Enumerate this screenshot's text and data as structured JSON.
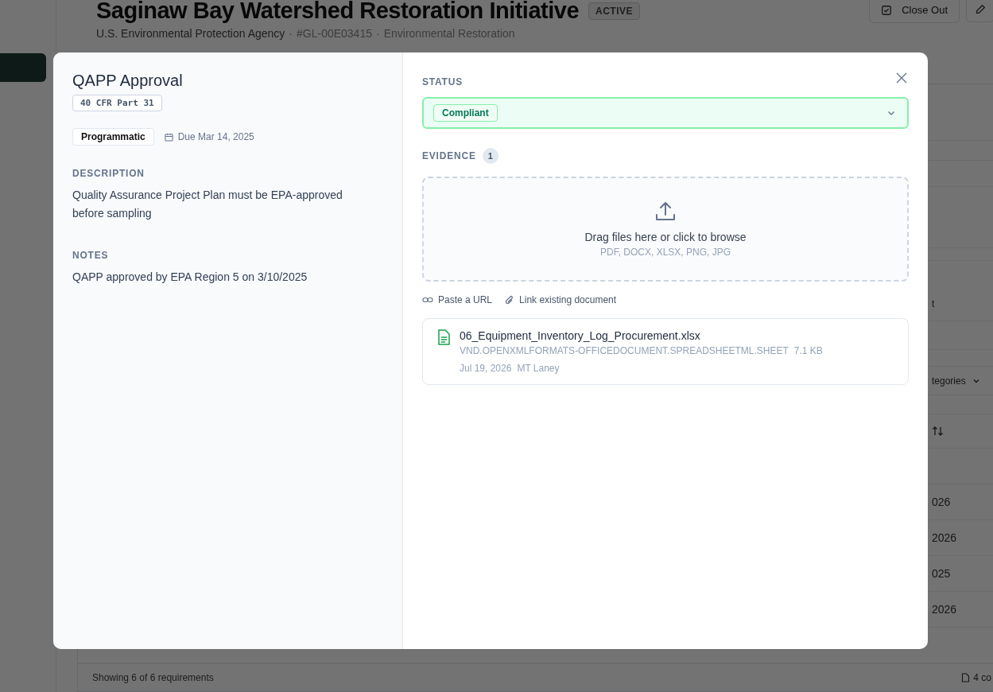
{
  "page": {
    "title": "Saginaw Bay Watershed Restoration Initiative",
    "status_badge": "ACTIVE",
    "subtitle": [
      "U.S. Environmental Protection Agency",
      "#GL-00E03415",
      "Environmental Restoration"
    ],
    "subtitle_separator": "·",
    "close_out_button": "Close Out",
    "table": {
      "column_fragment": "t",
      "filter_fragment": "tegories",
      "date_fragments": [
        "026",
        "2026",
        "025",
        "2026"
      ]
    },
    "footer": {
      "count": "Showing 6 of 6 requirements",
      "documents_fragment": "4 co"
    }
  },
  "modal": {
    "title": "QAPP Approval",
    "citation": "40 CFR Part 31",
    "category": "Programmatic",
    "due": "Due Mar 14, 2025",
    "description_label": "DESCRIPTION",
    "description": "Quality Assurance Project Plan must be EPA-approved before sampling",
    "notes_label": "NOTES",
    "notes": "QAPP approved by EPA Region 5 on 3/10/2025",
    "status_label": "STATUS",
    "status": "Compliant",
    "evidence_label": "EVIDENCE",
    "evidence_count": "1",
    "dropzone": {
      "title": "Drag files here or click to browse",
      "formats": "PDF, DOCX, XLSX, PNG, JPG"
    },
    "link_actions": [
      {
        "kind": "url",
        "label": "Paste a URL"
      },
      {
        "kind": "attach",
        "label": "Link existing document"
      }
    ],
    "files": [
      {
        "name": "06_Equipment_Inventory_Log_Procurement.xlsx",
        "mime": "VND.OPENXMLFORMATS-OFFICEDOCUMENT.SPREADSHEETML.SHEET",
        "size": "7.1 KB",
        "date": "Jul 19, 2026",
        "uploader": "MT Laney"
      }
    ]
  }
}
